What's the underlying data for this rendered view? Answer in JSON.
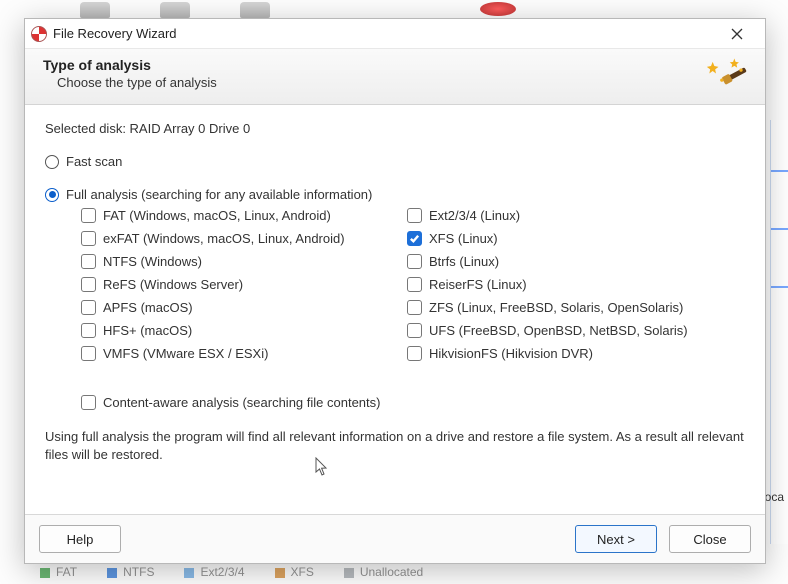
{
  "titlebar": {
    "title": "File Recovery Wizard"
  },
  "header": {
    "title": "Type of analysis",
    "subtitle": "Choose the type of analysis"
  },
  "selected_disk_label": "Selected disk: RAID Array 0 Drive 0",
  "scan": {
    "fast_label": "Fast scan",
    "full_label": "Full analysis (searching for any available information)",
    "selected": "full"
  },
  "filesystems_left": [
    {
      "key": "fat",
      "label": "FAT (Windows, macOS, Linux, Android)",
      "checked": false
    },
    {
      "key": "exfat",
      "label": "exFAT (Windows, macOS, Linux, Android)",
      "checked": false
    },
    {
      "key": "ntfs",
      "label": "NTFS (Windows)",
      "checked": false
    },
    {
      "key": "refs",
      "label": "ReFS (Windows Server)",
      "checked": false
    },
    {
      "key": "apfs",
      "label": "APFS (macOS)",
      "checked": false
    },
    {
      "key": "hfs",
      "label": "HFS+ (macOS)",
      "checked": false
    },
    {
      "key": "vmfs",
      "label": "VMFS (VMware ESX / ESXi)",
      "checked": false
    }
  ],
  "filesystems_right": [
    {
      "key": "ext",
      "label": "Ext2/3/4 (Linux)",
      "checked": false
    },
    {
      "key": "xfs",
      "label": "XFS (Linux)",
      "checked": true
    },
    {
      "key": "btrfs",
      "label": "Btrfs (Linux)",
      "checked": false
    },
    {
      "key": "reiserfs",
      "label": "ReiserFS (Linux)",
      "checked": false
    },
    {
      "key": "zfs",
      "label": "ZFS (Linux, FreeBSD, Solaris, OpenSolaris)",
      "checked": false
    },
    {
      "key": "ufs",
      "label": "UFS (FreeBSD, OpenBSD, NetBSD, Solaris)",
      "checked": false
    },
    {
      "key": "hikvision",
      "label": "HikvisionFS (Hikvision DVR)",
      "checked": false
    }
  ],
  "content_aware": {
    "label": "Content-aware analysis (searching file contents)",
    "checked": false
  },
  "description": "Using full analysis the program will find all relevant information on a drive and restore a file system. As a result all relevant files will be restored.",
  "footer": {
    "help": "Help",
    "next": "Next >",
    "close": "Close"
  },
  "background": {
    "right_label": "Alloca",
    "legend": [
      "FAT",
      "NTFS",
      "Ext2/3/4",
      "XFS",
      "Unallocated"
    ],
    "legend_colors": [
      "#2e9a3a",
      "#1a6bd6",
      "#5aa0e0",
      "#d07f1f",
      "#9aa0a6"
    ]
  }
}
